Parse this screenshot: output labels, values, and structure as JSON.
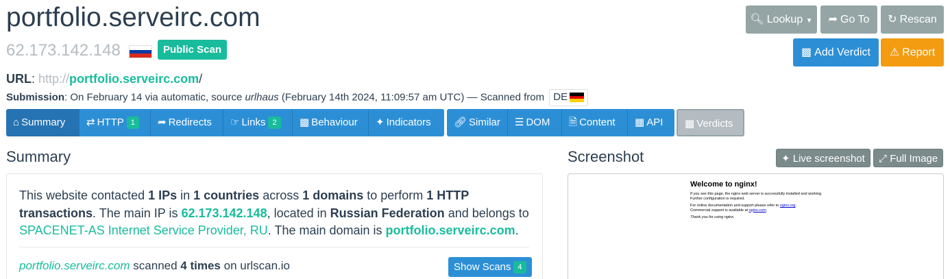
{
  "header": {
    "hostname": "portfolio.serveirc.com",
    "ip": "62.173.142.148",
    "scan_badge": "Public Scan"
  },
  "actions": {
    "lookup": "Lookup",
    "goto": "Go To",
    "rescan": "Rescan",
    "add_verdict": "Add Verdict",
    "report": "Report"
  },
  "url": {
    "label": "URL",
    "protocol": "http://",
    "domain": "portfolio.serveirc.com",
    "path": "/"
  },
  "submission": {
    "label": "Submission",
    "text_before": ": On February 14 via automatic, source ",
    "source": "urlhaus",
    "text_after": " (February 14th 2024, 11:09:57 am UTC) — Scanned from ",
    "country": "DE"
  },
  "tabs": [
    {
      "label": "Summary"
    },
    {
      "label": "HTTP",
      "badge": "1"
    },
    {
      "label": "Redirects"
    },
    {
      "label": "Links",
      "badge": "2"
    },
    {
      "label": "Behaviour"
    },
    {
      "label": "Indicators"
    }
  ],
  "tabs2": [
    {
      "label": "Similar"
    },
    {
      "label": "DOM"
    },
    {
      "label": "Content"
    },
    {
      "label": "API"
    }
  ],
  "verdicts_tab": "Verdicts",
  "summary": {
    "heading": "Summary",
    "p1": "This website contacted ",
    "ips": "1 IPs",
    "p2": " in ",
    "countries": "1 countries",
    "p3": " across ",
    "domains": "1 domains",
    "p4": " to perform ",
    "transactions": "1 HTTP transactions",
    "p5": ". The main IP is ",
    "main_ip": "62.173.142.148",
    "p6": ", located in ",
    "location": "Russian Federation",
    "p7": " and belongs to ",
    "asn": "SPACENET-AS Internet Service Provider, RU",
    "p8": ". The main domain is ",
    "main_domain": "portfolio.serveirc.com",
    "p9": ".",
    "scanned_domain": "portfolio.serveirc.com",
    "scanned_mid": " scanned ",
    "scanned_count": "4 times",
    "scanned_end": " on urlscan.io",
    "show_scans": "Show Scans",
    "show_scans_badge": "4"
  },
  "screenshot": {
    "heading": "Screenshot",
    "live": "Live screenshot",
    "full": "Full Image",
    "page_title": "Welcome to nginx!",
    "line1": "If you see this page, the nginx web server is successfully installed and working. Further configuration is required.",
    "line2a": "For online documentation and support please refer to ",
    "line2b": "nginx.org",
    "line2c": ".",
    "line3a": "Commercial support is available at ",
    "line3b": "nginx.com",
    "line3c": ".",
    "line4": "Thank you for using nginx."
  },
  "colors": {
    "primary": "#2c8fd6",
    "success": "#18bc9c",
    "warning": "#f39c12",
    "grey": "#95a5a6"
  }
}
